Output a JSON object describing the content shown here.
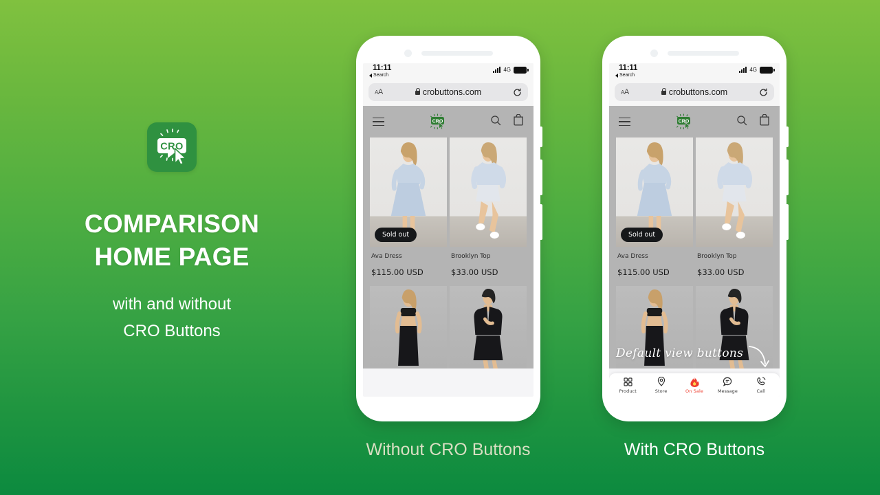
{
  "theme": {
    "bg_gradient_top": "#80c13f",
    "bg_gradient_bottom": "#0c8a3f",
    "brand_green": "#2f9140",
    "accent_red": "#ef3c2d",
    "caption_left_color": "#d9dfc3",
    "caption_right_color": "#ffffff"
  },
  "left_panel": {
    "logo": {
      "icon": "cro-app-logo-icon",
      "text": "CRO"
    },
    "headline_line1": "COMPARISON",
    "headline_line2": "HOME PAGE",
    "subhead_line1": "with and without",
    "subhead_line2": "CRO Buttons"
  },
  "phones": [
    {
      "id": "without-cro-buttons",
      "caption": "Without CRO Buttons",
      "has_cro_nav": false,
      "has_annotation": false
    },
    {
      "id": "with-cro-buttons",
      "caption": "With CRO Buttons",
      "has_cro_nav": true,
      "has_annotation": true,
      "annotation_text": "Default view buttons"
    }
  ],
  "status_bar": {
    "time": "11:11",
    "back_label": "Search",
    "network": "4G",
    "signal_icon": "signal-bars-icon",
    "battery_icon": "battery-full-icon"
  },
  "browser": {
    "text_size_label": "AA",
    "lock_icon": "lock-icon",
    "url": "crobuttons.com",
    "reload_icon": "reload-icon"
  },
  "site_header": {
    "menu_icon": "hamburger-menu-icon",
    "logo_text": "CRO",
    "logo_icon": "cro-logo-icon",
    "search_icon": "search-icon",
    "cart_icon": "shopping-bag-icon"
  },
  "products": [
    {
      "name": "Ava Dress",
      "price": "$115.00 USD",
      "badge": "Sold out",
      "image_alt": "model-in-light-blue-dress"
    },
    {
      "name": "Brooklyn Top",
      "price": "$33.00 USD",
      "badge": null,
      "image_alt": "model-in-light-blue-top-and-shorts"
    },
    {
      "name": null,
      "price": null,
      "badge": null,
      "image_alt": "model-in-black-crop-top-and-pants"
    },
    {
      "name": null,
      "price": null,
      "badge": null,
      "image_alt": "model-in-black-blazer-and-skirt"
    }
  ],
  "cro_nav": {
    "items": [
      {
        "label": "Product",
        "icon": "grid-squares-icon",
        "active": false
      },
      {
        "label": "Store",
        "icon": "location-pin-icon",
        "active": false
      },
      {
        "label": "On Sale",
        "icon": "flame-icon",
        "active": true
      },
      {
        "label": "Message",
        "icon": "chat-bubble-icon",
        "active": false
      },
      {
        "label": "Call",
        "icon": "phone-call-icon",
        "active": false
      }
    ]
  }
}
